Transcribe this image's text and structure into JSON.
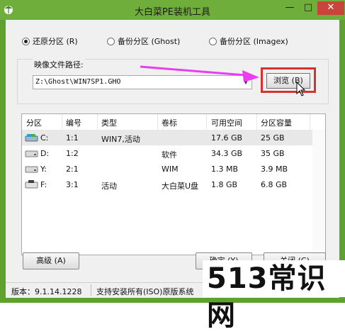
{
  "window": {
    "title": "大白菜PE装机工具",
    "controls": {
      "minimize": "—",
      "maximize": "□",
      "close": "✕"
    },
    "title_bar_color": "#6fae3b",
    "close_color": "#c9443c"
  },
  "mode": {
    "options": [
      {
        "label": "还原分区 (R)",
        "selected": true
      },
      {
        "label": "备份分区 (Ghost)",
        "selected": false
      },
      {
        "label": "备份分区 (Imagex)",
        "selected": false
      }
    ]
  },
  "image_path": {
    "label": "映像文件路径:",
    "value": "Z:\\Ghost\\WIN7SP1.GHO",
    "browse_label": "浏览 (B)"
  },
  "annotation": {
    "arrow_color": "#e83ef0",
    "highlight_color": "#d8322e"
  },
  "table": {
    "columns": [
      "分区",
      "编号",
      "类型",
      "卷标",
      "可用空间",
      "分区容量"
    ],
    "rows": [
      {
        "drive": "C:",
        "num": "1:1",
        "type": "WIN7,活动",
        "label": "",
        "free": "17.6 GB",
        "size": "25 GB",
        "selected": true,
        "icon": "system-drive-icon"
      },
      {
        "drive": "D:",
        "num": "1:2",
        "type": "",
        "label": "软件",
        "free": "34.3 GB",
        "size": "35 GB",
        "selected": false,
        "icon": "hard-drive-icon"
      },
      {
        "drive": "Y:",
        "num": "2:1",
        "type": "",
        "label": "WIM",
        "free": "1.3 MB",
        "size": "3.9 MB",
        "selected": false,
        "icon": "hard-drive-icon"
      },
      {
        "drive": "F:",
        "num": "3:1",
        "type": "活动",
        "label": "大白菜U盘",
        "free": "1.8 GB",
        "size": "6.8 GB",
        "selected": false,
        "icon": "usb-drive-icon"
      }
    ]
  },
  "buttons": {
    "advanced": "高级 (A)",
    "ok": "确定 (Y)",
    "close": "关闭 (C)"
  },
  "status": {
    "version": "版本：9.1.14.1228",
    "message": "支持安装所有(ISO)原版系统"
  },
  "watermark": "513常识网"
}
